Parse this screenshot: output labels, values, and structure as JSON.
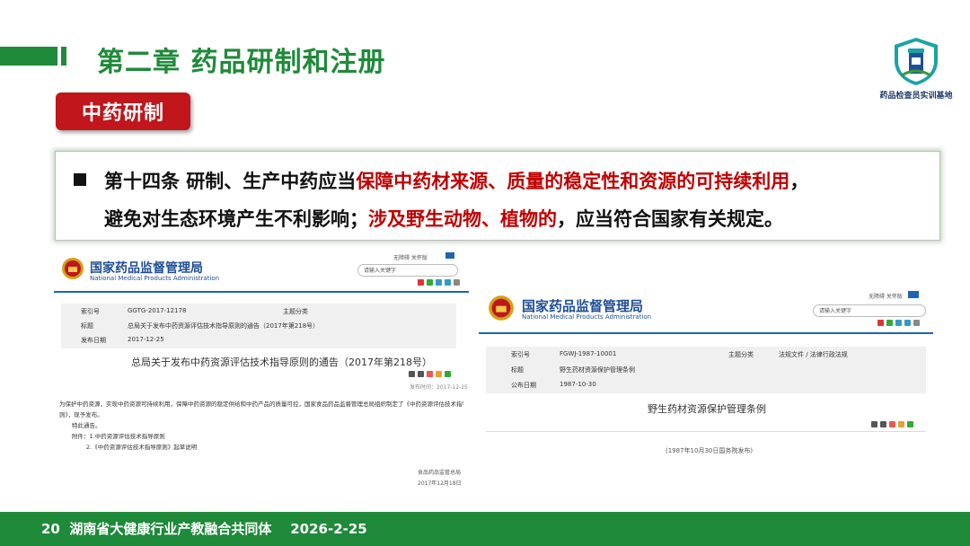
{
  "header": {
    "chapter_title": "第二章  药品研制和注册"
  },
  "logo": {
    "caption": "药品检查员实训基地"
  },
  "section": {
    "tag": "中药研制"
  },
  "article": {
    "line1_a": "第十四条   研制、生产中药应当",
    "line1_red": "保障中药材来源、质量的稳定性和资源的可持续利用",
    "line1_b": "，",
    "line2_a": "避免对生态环境产生不利影响；",
    "line2_red": "涉及野生动物、植物的",
    "line2_b": "，应当符合国家有关规定。"
  },
  "doc1": {
    "agency_cn": "国家药品监督管理局",
    "agency_en": "National Medical Products Administration",
    "top_links": "无障碍   关怀版",
    "search_placeholder": "请输入关键字",
    "rows": [
      {
        "label": "索引号",
        "value": "GGTG-2017-12178",
        "label2": "主题分类",
        "value2": ""
      },
      {
        "label": "标题",
        "value": "总局关于发布中药资源评估技术指导原则的通告（2017年第218号）"
      },
      {
        "label": "发布日期",
        "value": "2017-12-25"
      }
    ],
    "title": "总局关于发布中药资源评估技术指导原则的通告（2017年第218号）",
    "publish_meta": "发布时间：2017-12-25",
    "body_line1": "为保护中药资源，实现中药资源可持续利用，保障中药资源的稳定供给和中药产品的质量可控，国家食品药品监督管理总局组织制定了《中药资源评估技术指导原",
    "body_line2": "则》，现予发布。",
    "body_line3": "特此通告。",
    "attach1": "附件：1.中药资源评估技术指导原则",
    "attach2": "2.《中药资源评估技术指导原则》起草说明",
    "sign_org": "食品药品监管总局",
    "sign_date": "2017年12月18日"
  },
  "doc2": {
    "agency_cn": "国家药品监督管理局",
    "agency_en": "National Medical Products Administration",
    "top_links": "无障碍   关怀版",
    "search_placeholder": "请输入关键字",
    "rows": [
      {
        "label": "索引号",
        "value": "FGWJ-1987-10001",
        "label2": "主题分类",
        "value2": "法规文件 / 法律行政法规"
      },
      {
        "label": "标题",
        "value": "野生药材资源保护管理条例"
      },
      {
        "label": "公布日期",
        "value": "1987-10-30"
      }
    ],
    "title": "野生药材资源保护管理条例",
    "note": "(1987年10月30日国务院发布)"
  },
  "footer": {
    "page_num": "20",
    "org": "湖南省大健康行业产教融合共同体",
    "date": "2026-2-25"
  }
}
